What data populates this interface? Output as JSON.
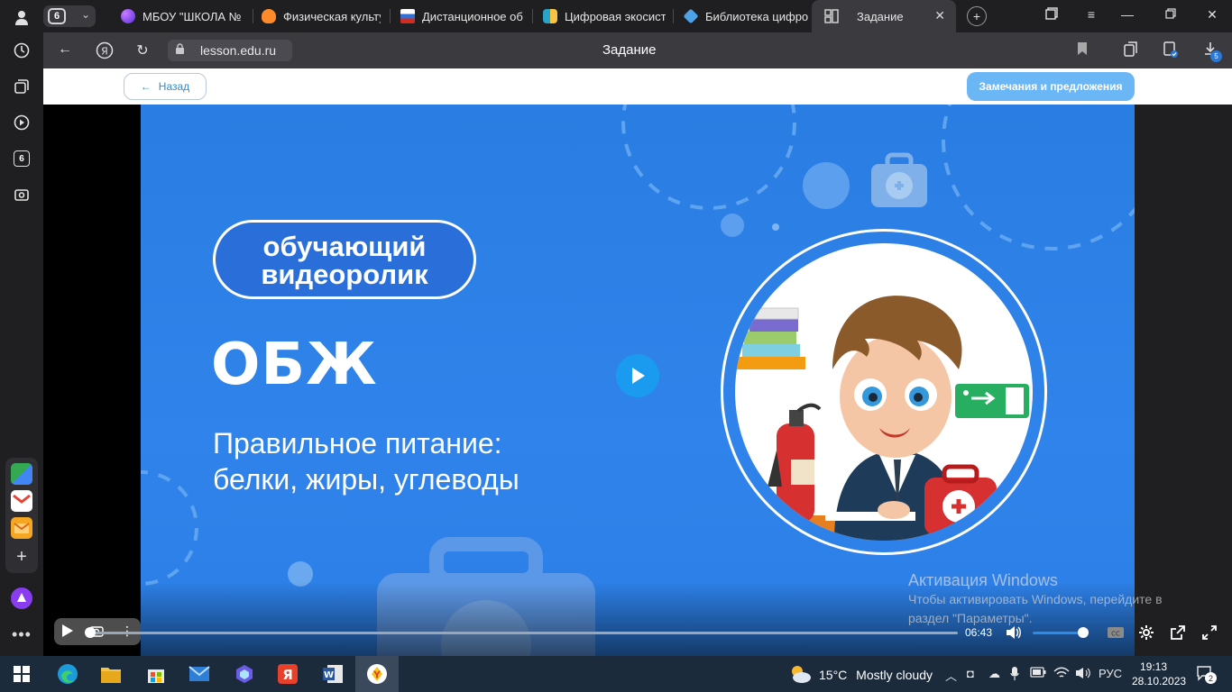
{
  "browser": {
    "tab_count": "6",
    "tabs": [
      {
        "title": "МБОУ \"ШКОЛА №",
        "color": "#7b3fe4"
      },
      {
        "title": "Физическая культу",
        "color": "#ff8a2b"
      },
      {
        "title": "Дистанционное об",
        "color": "#2e6fd8"
      },
      {
        "title": "Цифровая экосист",
        "color": "#27a3c8"
      },
      {
        "title": "Библиотека цифро",
        "color": "#4ea2e8"
      }
    ],
    "active_tab": {
      "title": "Задание"
    },
    "url": "lesson.edu.ru",
    "page_title": "Задание",
    "downloads_count": "5",
    "sidebar_badge": "6"
  },
  "page": {
    "back_label": "Назад",
    "feedback_label": "Замечания и предложения"
  },
  "slide": {
    "pill_line1": "обучающий",
    "pill_line2": "видеоролик",
    "subject": "ОБЖ",
    "topic_line1": "Правильное питание:",
    "topic_line2": "белки, жиры, углеводы"
  },
  "player": {
    "time": "06:43",
    "progress": 0.0,
    "volume": 0.9
  },
  "watermark": {
    "title": "Активация Windows",
    "line1": "Чтобы активировать Windows, перейдите в",
    "line2": "раздел \"Параметры\"."
  },
  "taskbar": {
    "weather_temp": "15°C",
    "weather_desc": "Mostly cloudy",
    "lang": "РУС",
    "time": "19:13",
    "date": "28.10.2023",
    "notifications": "2"
  },
  "colors": {
    "slide_blue": "#2a7de2",
    "accent_link": "#2e8bd8",
    "feedback_bg": "#6bb6f4"
  }
}
